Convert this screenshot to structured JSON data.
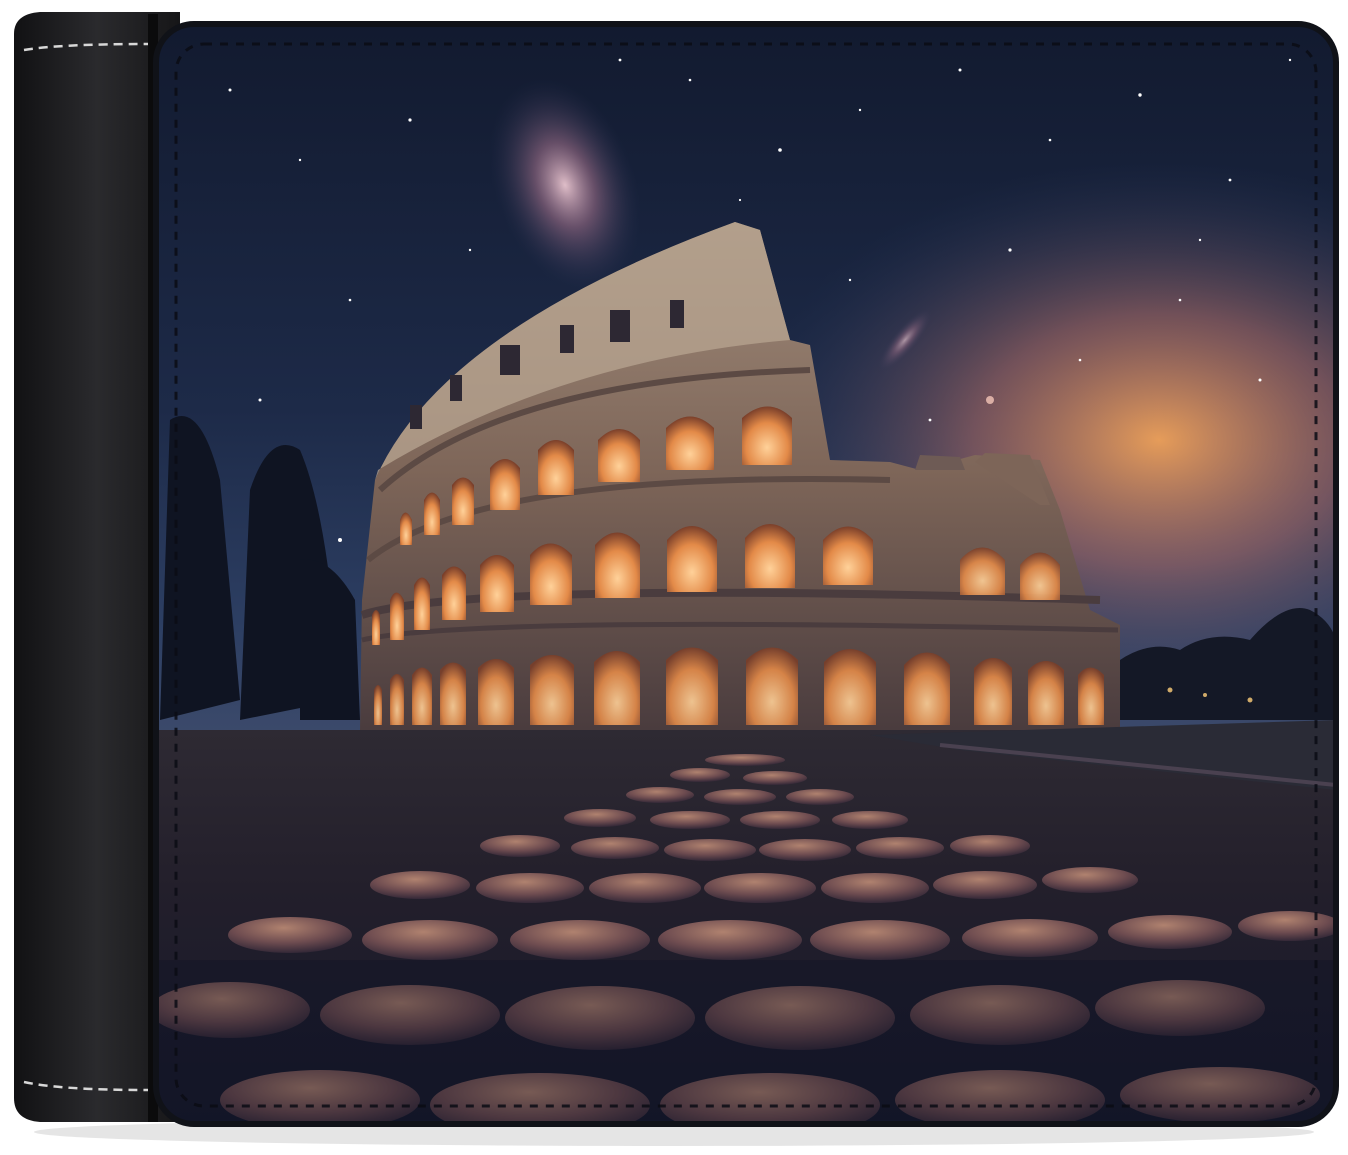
{
  "product": {
    "subject": "wallet-with-colosseum-night-print",
    "colors": {
      "leather": "#1c1c1e",
      "stitch": "#d8d8d8",
      "sky_top": "#131a30",
      "sky_mid": "#243352",
      "sunset": "#e59a57",
      "arch_glow": "#f1a05c",
      "stone": "#8f7866",
      "road": "#1d2232"
    }
  }
}
